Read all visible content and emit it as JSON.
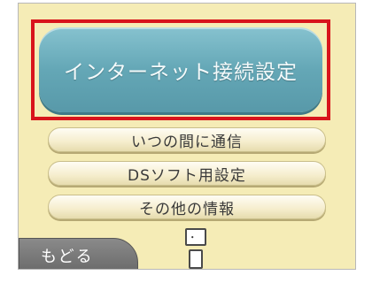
{
  "menu": {
    "primary_label": "インターネット接続設定",
    "items": [
      {
        "label": "いつの間に通信"
      },
      {
        "label": "DSソフト用設定"
      },
      {
        "label": "その他の情報"
      }
    ]
  },
  "footer": {
    "back_label": "もどる",
    "robot_face": "･‿･"
  },
  "colors": {
    "screen_background": "#f5ecb6",
    "primary_button": "#64a7b6",
    "highlight_frame": "#d8141c",
    "back_tab": "#7a7a7a"
  }
}
